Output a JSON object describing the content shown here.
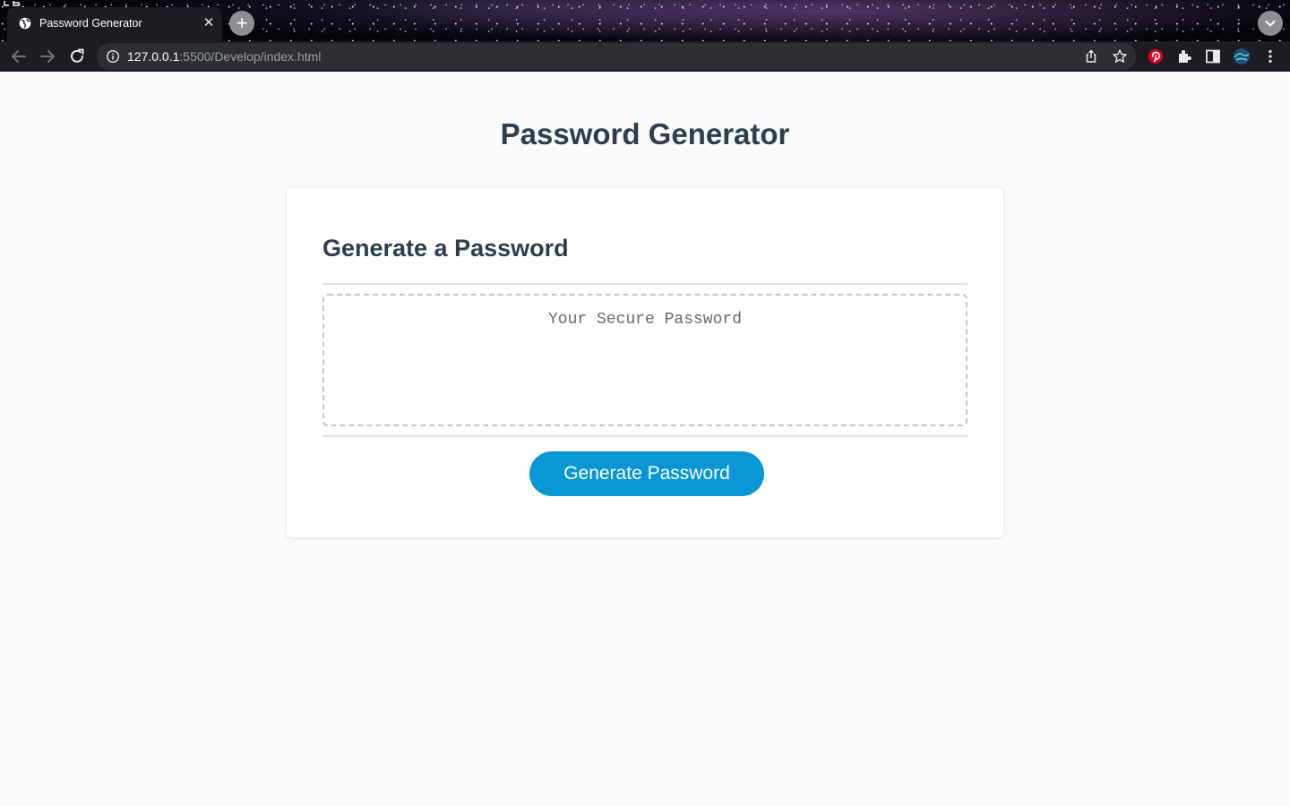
{
  "browser": {
    "tab": {
      "title": "Password Generator",
      "close_glyph": "✕"
    },
    "new_tab_glyph": "+",
    "address_bar": {
      "host": "127.0.0.1",
      "rest": ":5500/Develop/index.html"
    },
    "icons": [
      "back-icon",
      "forward-icon",
      "reload-icon",
      "info-icon",
      "share-icon",
      "star-icon",
      "pinterest-icon",
      "extensions-icon",
      "sidepanel-icon",
      "profile-icon",
      "menu-icon"
    ]
  },
  "page": {
    "title": "Password Generator",
    "card": {
      "header": "Generate a Password",
      "password": {
        "value": "",
        "placeholder": "Your Secure Password"
      },
      "button_label": "Generate Password"
    }
  },
  "colors": {
    "heading": "#2d3e50",
    "button": "#0897d4",
    "page_background": "#f9fafc",
    "card_background": "#ffffff"
  }
}
